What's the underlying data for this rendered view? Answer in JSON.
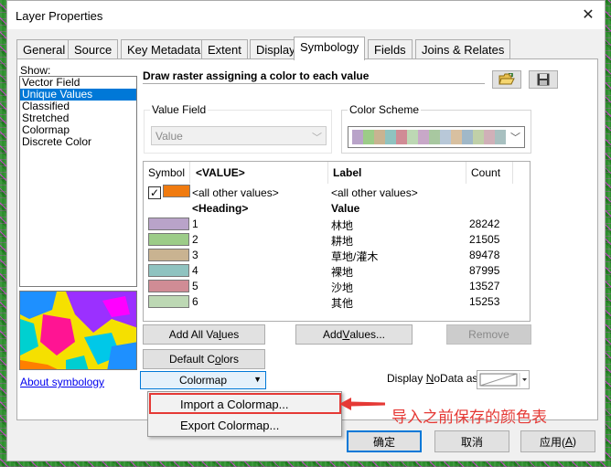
{
  "window": {
    "title": "Layer Properties",
    "close": "✕"
  },
  "tabs": [
    "General",
    "Source",
    "Key Metadata",
    "Extent",
    "Display",
    "Symbology",
    "Fields",
    "Joins & Relates"
  ],
  "active_tab": "Symbology",
  "show": {
    "label": "Show:",
    "items": [
      "Vector Field",
      "Unique Values",
      "Classified",
      "Stretched",
      "Colormap",
      "Discrete Color"
    ],
    "selected": "Unique Values"
  },
  "about_link": "About symbology",
  "description": "Draw raster assigning a color to each value",
  "value_field": {
    "label": "Value Field",
    "value": "Value"
  },
  "color_scheme": {
    "label": "Color Scheme",
    "colors": [
      "#b9a3c9",
      "#9ccc88",
      "#c9b391",
      "#8fc3c0",
      "#d08c95",
      "#bdd8b4",
      "#c8a8c8",
      "#a8c8a0",
      "#b8c8d8",
      "#d8c0a0",
      "#a0b8c8",
      "#c0d0a8",
      "#d0b0b8",
      "#a8c0c0"
    ]
  },
  "table": {
    "headers": {
      "symbol": "Symbol",
      "value": "<VALUE>",
      "label": "Label",
      "count": "Count"
    },
    "other_row": {
      "color": "#f07b10",
      "value": "<all other values>",
      "label": "<all other values>",
      "checked": true
    },
    "heading_row": {
      "value": "<Heading>",
      "label": "Value"
    },
    "rows": [
      {
        "color": "#b9a3c9",
        "value": "1",
        "label": "林地",
        "count": "28242"
      },
      {
        "color": "#9ccc88",
        "value": "2",
        "label": "耕地",
        "count": "21505"
      },
      {
        "color": "#c9b391",
        "value": "3",
        "label": "草地/灌木",
        "count": "89478"
      },
      {
        "color": "#8fc3c0",
        "value": "4",
        "label": "裸地",
        "count": "87995"
      },
      {
        "color": "#d08c95",
        "value": "5",
        "label": "沙地",
        "count": "13527"
      },
      {
        "color": "#bdd8b4",
        "value": "6",
        "label": "其他",
        "count": "15253"
      }
    ]
  },
  "buttons": {
    "add_all_values_pre": "Add All Va",
    "add_all_values_ul": "l",
    "add_all_values_post": "ues",
    "add_values_pre": "Add ",
    "add_values_ul": "V",
    "add_values_post": "alues...",
    "remove": "Remove",
    "default_colors_pre": "Default C",
    "default_colors_ul": "o",
    "default_colors_post": "lors",
    "colormap": "Colormap",
    "colormap_arrow": "▼"
  },
  "nodata": {
    "label_pre": "Display ",
    "label_ul": "N",
    "label_post": "oData as"
  },
  "menu": [
    "Import a Colormap...",
    "Export Colormap..."
  ],
  "annotation": "导入之前保存的颜色表",
  "bottom": {
    "ok": "确定",
    "cancel": "取消",
    "apply_pre": "应用(",
    "apply_ul": "A",
    "apply_post": ")"
  }
}
